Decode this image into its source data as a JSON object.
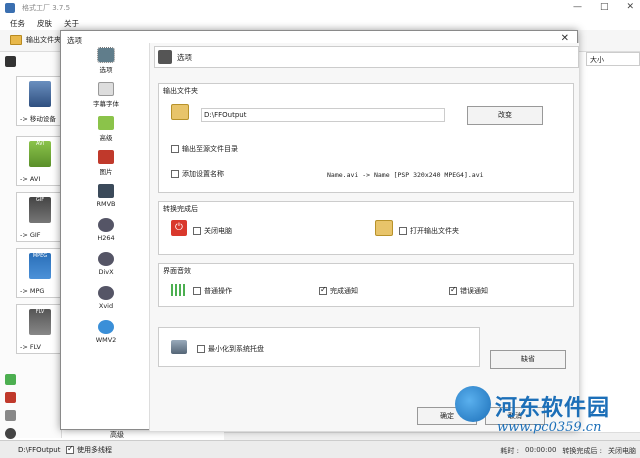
{
  "window": {
    "title": "格式工厂 3.7.5",
    "minimize": "—",
    "maximize": "□",
    "close": "✕"
  },
  "menu": [
    "任务",
    "皮肤",
    "关于"
  ],
  "toolbar": {
    "output_folder": "输出文件夹"
  },
  "sort_label": "大小",
  "converters": [
    {
      "label": "-> 移动设备"
    },
    {
      "label": "-> AVI"
    },
    {
      "label": "-> GIF"
    },
    {
      "label": "-> MPG"
    },
    {
      "label": "-> FLV"
    }
  ],
  "converter_badges": [
    "",
    "AVI",
    "GIF",
    "MPEG",
    "FLV"
  ],
  "left_bottom_label": "高级",
  "status": {
    "path": "D:\\FFOutput",
    "multithread_label": "使用多线程",
    "multithread_checked": true,
    "elapsed_label": "耗时 :",
    "elapsed": "00:00:00",
    "after_label": "转换完成后 :",
    "after_value": "关闭电脑"
  },
  "dialog": {
    "title": "选项",
    "close": "✕",
    "nav": [
      {
        "label": "选项",
        "icon": "options-icon",
        "selected": true
      },
      {
        "label": "字幕字体",
        "icon": "font-icon"
      },
      {
        "label": "高级",
        "icon": "advanced-icon"
      },
      {
        "label": "图片",
        "icon": "picture-icon"
      },
      {
        "label": "RMVB",
        "icon": "rmvb-icon"
      },
      {
        "label": "H264",
        "icon": "h264-icon"
      },
      {
        "label": "DivX",
        "icon": "divx-icon"
      },
      {
        "label": "Xvid",
        "icon": "xvid-icon"
      },
      {
        "label": "WMV2",
        "icon": "wmv2-icon"
      }
    ],
    "panel_title": "选项",
    "output": {
      "group_title": "输出文件夹",
      "path": "D:\\FFOutput",
      "change_button": "改变",
      "to_source_label": "输出至源文件目录",
      "to_source_checked": false,
      "add_setting_name_label": "添加设置名称",
      "add_setting_name_checked": false,
      "preview": "Name.avi  -> Name [PSP 320x240 MPEG4].avi"
    },
    "after": {
      "group_title": "转换完成后",
      "shutdown_label": "关闭电脑",
      "shutdown_checked": false,
      "open_folder_label": "打开输出文件夹",
      "open_folder_checked": false
    },
    "sound": {
      "group_title": "界面音效",
      "normal_label": "普通操作",
      "normal_checked": false,
      "done_label": "完成通知",
      "done_checked": true,
      "error_label": "错误通知",
      "error_checked": true
    },
    "tray": {
      "minimize_label": "最小化到系统托盘",
      "minimize_checked": false
    },
    "default_button": "缺省",
    "ok_button": "确定",
    "cancel_button": "取消"
  },
  "watermark": {
    "title": "河东软件园",
    "url": "www.pc0359.cn"
  },
  "colors": {
    "folder": "#e8c46a",
    "power_red": "#d9382c",
    "brand_blue": "#1c6fb8"
  }
}
